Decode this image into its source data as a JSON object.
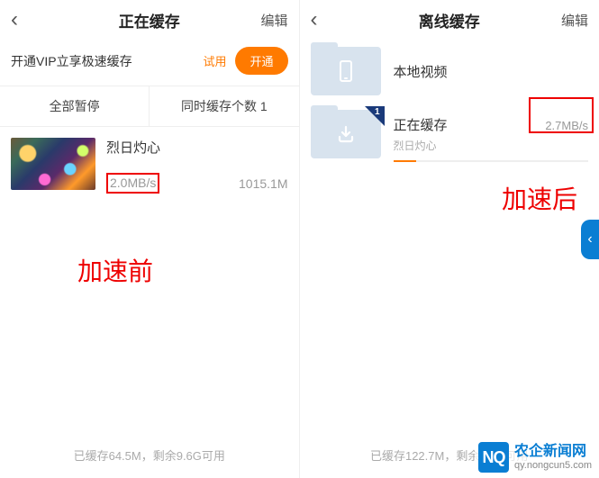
{
  "left": {
    "header": {
      "title": "正在缓存",
      "edit": "编辑"
    },
    "vip": {
      "text": "开通VIP立享极速缓存",
      "trial": "试用",
      "open": "开通"
    },
    "tabs": {
      "pause_all": "全部暂停",
      "concurrent": "同时缓存个数 1"
    },
    "item": {
      "title": "烈日灼心",
      "speed": "2.0MB/s",
      "size": "1015.1M"
    },
    "annotation": "加速前",
    "footer": "已缓存64.5M，剩余9.6G可用"
  },
  "right": {
    "header": {
      "title": "离线缓存",
      "edit": "编辑"
    },
    "rows": {
      "local": {
        "title": "本地视频"
      },
      "caching": {
        "title": "正在缓存",
        "sub": "烈日灼心",
        "speed": "2.7MB/s",
        "badge": "1"
      }
    },
    "annotation": "加速后",
    "footer": "已缓存122.7M，剩余9.5G可用"
  },
  "watermark": {
    "cn": "农企新闻网",
    "url": "qy.nongcun5.com",
    "logo": "NQ"
  }
}
